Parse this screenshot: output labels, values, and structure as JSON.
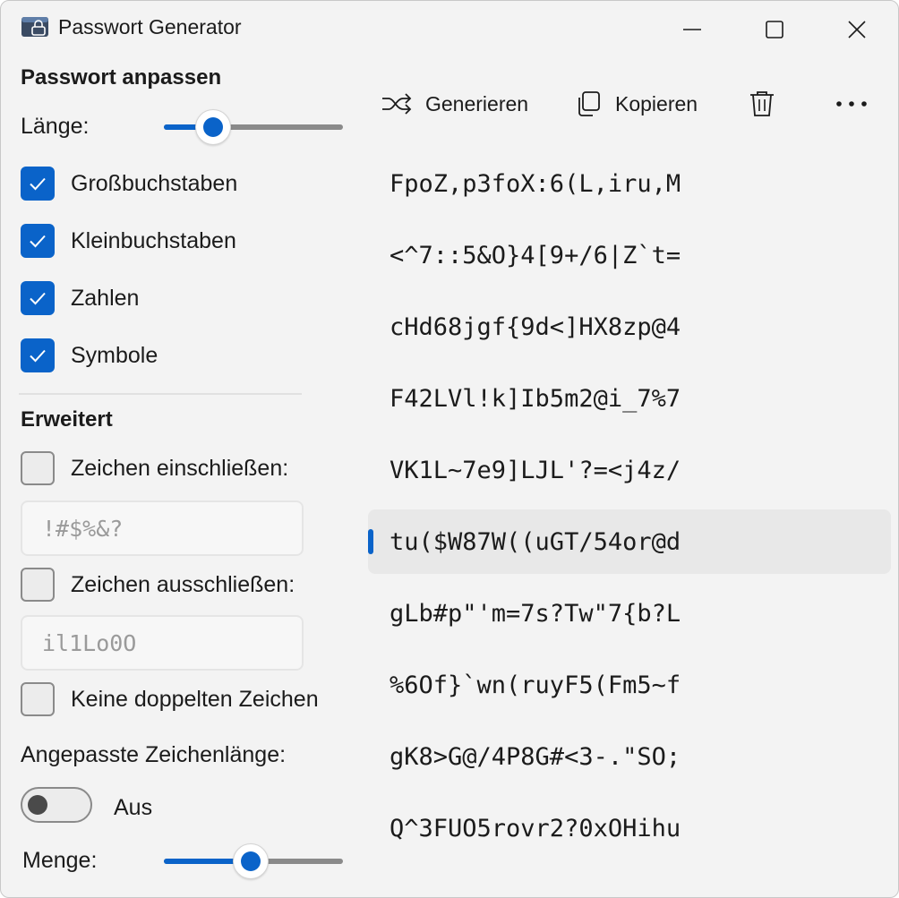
{
  "window": {
    "title": "Passwort Generator"
  },
  "settings": {
    "heading": "Passwort anpassen",
    "length": {
      "label": "Länge:",
      "value_fraction": 0.27
    },
    "options": [
      {
        "label": "Großbuchstaben",
        "checked": true
      },
      {
        "label": "Kleinbuchstaben",
        "checked": true
      },
      {
        "label": "Zahlen",
        "checked": true
      },
      {
        "label": "Symbole",
        "checked": true
      }
    ]
  },
  "advanced": {
    "heading": "Erweitert",
    "include": {
      "label": "Zeichen einschließen:",
      "checked": false,
      "placeholder": "!#$%&?"
    },
    "exclude": {
      "label": "Zeichen ausschließen:",
      "checked": false,
      "placeholder": "il1Lo0O"
    },
    "no_duplicates": {
      "label": "Keine doppelten Zeichen",
      "checked": false
    },
    "custom_length": {
      "label": "Angepasste Zeichenlänge:",
      "toggle_label": "Aus",
      "on": false
    },
    "quantity": {
      "label": "Menge:",
      "value_fraction": 0.48
    }
  },
  "toolbar": {
    "generate_label": "Generieren",
    "copy_label": "Kopieren"
  },
  "passwords": [
    "FpoZ,p3foX:6(L,iru,M",
    "<^7::5&O}4[9+/6|Z`t=",
    "cHd68jgf{9d<]HX8zp@4",
    "F42LVl!k]Ib5m2@i_7%7",
    "VK1L~7e9]LJL'?=<j4z/",
    "tu($W87W((uGT/54or@d",
    "gLb#p\"'m=7s?Tw\"7{b?L",
    "%6Of}`wn(ruyF5(Fm5~f",
    "gK8>G@/4P8G#<3-.\"SO;",
    "Q^3FUO5rovr2?0xOHihu"
  ],
  "selected_index": 5,
  "colors": {
    "accent": "#0a63c9",
    "background": "#f3f3f3",
    "selected_row": "#e8e8e8"
  }
}
